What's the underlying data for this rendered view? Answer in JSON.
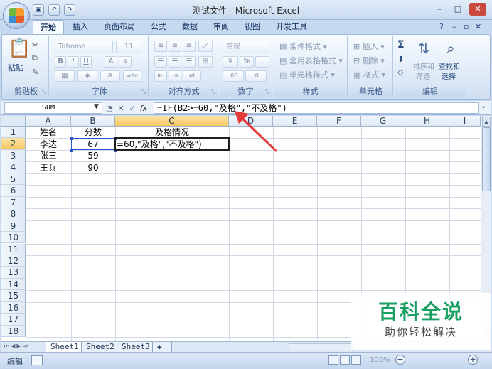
{
  "window": {
    "title": "测试文件 - Microsoft Excel",
    "minimize": "–",
    "maximize": "□",
    "close": "✕"
  },
  "quick_access": {
    "save_icon": "save-icon",
    "undo_icon": "undo-icon",
    "redo_icon": "redo-icon"
  },
  "ribbon_tabs": [
    "开始",
    "插入",
    "页面布局",
    "公式",
    "数据",
    "审阅",
    "视图",
    "开发工具"
  ],
  "active_tab": "开始",
  "help": "?",
  "ribbon": {
    "clipboard": {
      "label": "剪贴板",
      "paste": "粘贴"
    },
    "font": {
      "label": "字体",
      "font_name": "Tahoma",
      "font_size": "11",
      "bold": "B",
      "italic": "I",
      "underline": "U",
      "grow": "A",
      "shrink": "A",
      "font_color": "A",
      "phonetic": "wén"
    },
    "alignment": {
      "label": "对齐方式"
    },
    "number": {
      "label": "数字",
      "format": "常规",
      "percent": "%",
      "comma": ",",
      "inc_decimal": ".00",
      "dec_decimal": ".0"
    },
    "styles": {
      "label": "样式",
      "conditional": "条件格式",
      "table": "套用表格格式",
      "cell_styles": "单元格样式"
    },
    "cells": {
      "label": "单元格",
      "insert": "插入",
      "delete": "删除",
      "format": "格式"
    },
    "editing": {
      "label": "编辑",
      "sum": "Σ",
      "sort": "排序和",
      "filter": "筛选",
      "find": "查找和",
      "select": "选择"
    }
  },
  "formula_bar": {
    "name_box": "SUM",
    "cancel": "✕",
    "enter": "✓",
    "fx": "fx",
    "formula": "=IF(B2>=60,\"及格\",\"不及格\")"
  },
  "grid": {
    "columns": [
      "A",
      "B",
      "C",
      "D",
      "E",
      "F",
      "G",
      "H",
      "I"
    ],
    "rows": [
      "1",
      "2",
      "3",
      "4",
      "5",
      "6",
      "7",
      "8",
      "9",
      "10",
      "11",
      "12",
      "13",
      "14",
      "15",
      "16",
      "17",
      "18"
    ],
    "cells": {
      "A1": "姓名",
      "B1": "分数",
      "C1": "及格情况",
      "A2": "李达",
      "B2": "67",
      "C2": "=60,\"及格\",\"不及格\")",
      "A3": "张三",
      "B3": "59",
      "A4": "王兵",
      "B4": "90"
    },
    "selected_column": "C",
    "selected_row": "2"
  },
  "sheets": {
    "tabs": [
      "Sheet1",
      "Sheet2",
      "Sheet3"
    ],
    "active": "Sheet1"
  },
  "status": {
    "mode": "编辑",
    "zoom": "100%"
  },
  "watermark": {
    "main": "百科全说",
    "sub": "助你轻松解决"
  },
  "colors": {
    "ribbon_bg": "#dde9f7",
    "header_selected": "#f6c75e",
    "watermark_green": "#18a063",
    "arrow_red": "#e63a3a"
  }
}
